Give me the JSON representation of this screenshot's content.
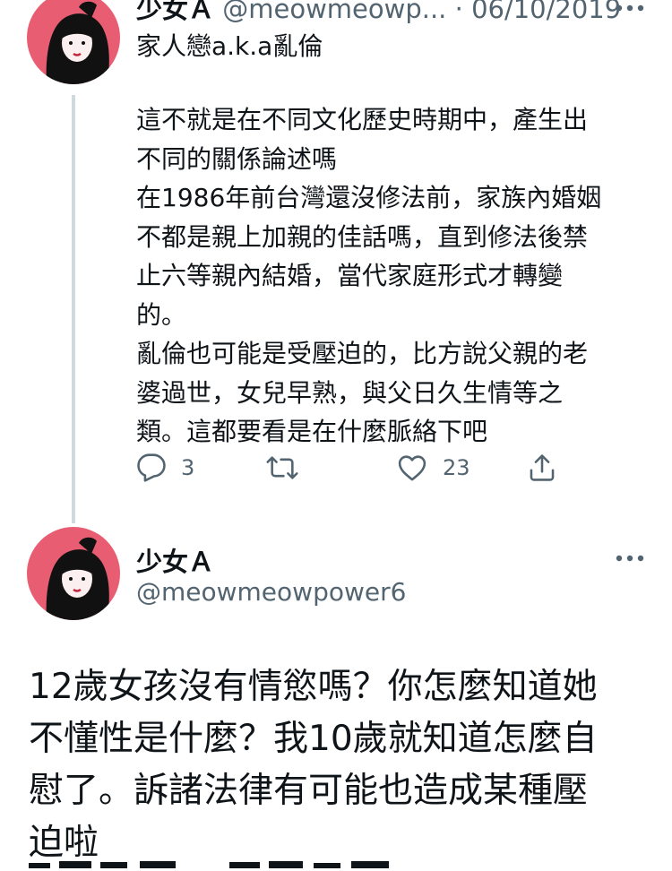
{
  "tweet1": {
    "display_name": "少女Ａ",
    "handle": "@meowmeowp...",
    "separator": " · ",
    "date": "06/10/2019",
    "reply_context": "家人戀a.k.a亂倫",
    "body_lines": [
      "這不就是在不同文化歷史時期中，產生出",
      "不同的關係論述嗎",
      "在1986年前台灣還沒修法前，家族內婚姻",
      "不都是親上加親的佳話嗎，直到修法後禁",
      "止六等親內結婚，當代家庭形式才轉變",
      "的。",
      "亂倫也可能是受壓迫的，比方說父親的老",
      "婆過世，女兒早熟，與父日久生情等之",
      "類。這都要看是在什麼脈絡下吧"
    ],
    "actions": {
      "reply_count": "3",
      "retweet_count": "",
      "like_count": "23"
    }
  },
  "tweet2": {
    "display_name": "少女Ａ",
    "handle": "@meowmeowpower6",
    "body_lines": [
      "12歲女孩沒有情慾嗎？你怎麼知道她",
      "不懂性是什麼？我10歲就知道怎麼自",
      "慰了。訴諸法律有可能也造成某種壓",
      "迫啦"
    ]
  },
  "colors": {
    "text_primary": "#0f1419",
    "text_secondary": "#536471",
    "thread_line": "#cfd9de",
    "avatar_bg": "#e85d72"
  },
  "icons": {
    "reply": "speech-bubble-icon",
    "retweet": "retweet-arrows-icon",
    "like": "heart-icon",
    "share": "share-upload-icon",
    "more": "ellipsis-icon"
  }
}
